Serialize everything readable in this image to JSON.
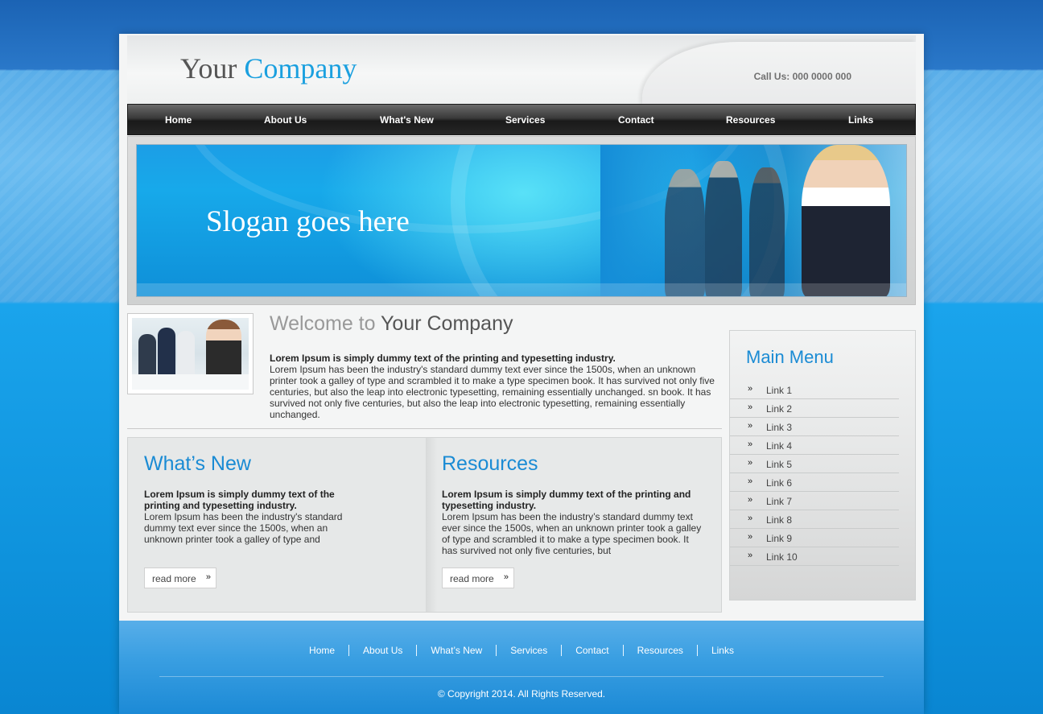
{
  "header": {
    "logo_part1": "Your",
    "logo_part2": "Company",
    "call_us": "Call Us: 000 0000 000"
  },
  "nav": {
    "items": [
      "Home",
      "About Us",
      "What's New",
      "Services",
      "Contact",
      "Resources",
      "Links"
    ]
  },
  "banner": {
    "slogan": "Slogan goes here"
  },
  "welcome": {
    "title_part1": "Welcome to",
    "title_part2": "Your Company",
    "lead": "Lorem Ipsum is simply dummy text of the printing and typesetting industry.",
    "body": "Lorem Ipsum has been the industry's standard dummy text ever since the 1500s, when an unknown printer took a galley of type and scrambled it to make a type specimen book. It has survived not only five centuries, but also the leap into electronic typesetting, remaining essentially unchanged. sn book. It has survived not only five centuries, but also the leap into electronic typesetting, remaining essentially unchanged."
  },
  "whats_new": {
    "title": "What’s New",
    "lead": "Lorem Ipsum is simply dummy text of the printing and typesetting industry.",
    "body": "Lorem Ipsum has been the industry's standard dummy text ever since the 1500s, when an unknown printer took a galley of type and",
    "read_more": "read more"
  },
  "resources": {
    "title": "Resources",
    "lead": "Lorem Ipsum is simply dummy text of the printing and typesetting industry.",
    "body": "Lorem Ipsum has been the industry’s standard dummy text ever since the 1500s, when an unknown printer took a galley of type and scrambled it to make a type specimen book. It has survived not only five centuries, but",
    "read_more": "read more"
  },
  "sidebar": {
    "title": "Main Menu",
    "links": [
      "Link 1",
      "Link 2",
      "Link 3",
      "Link 4",
      "Link 5",
      "Link 6",
      "Link 7",
      "Link 8",
      "Link 9",
      "Link 10"
    ]
  },
  "footer": {
    "links": [
      "Home",
      "About Us",
      "What’s New",
      "Services",
      "Contact",
      "Resources",
      "Links"
    ],
    "copyright": "© Copyright 2014. All Rights Reserved."
  },
  "colors": {
    "accent": "#1ba0df",
    "nav_bg": "#262626",
    "footer_bg": "#3a9fe2"
  },
  "icons": {
    "arrow": "double-chevron-right-icon"
  }
}
